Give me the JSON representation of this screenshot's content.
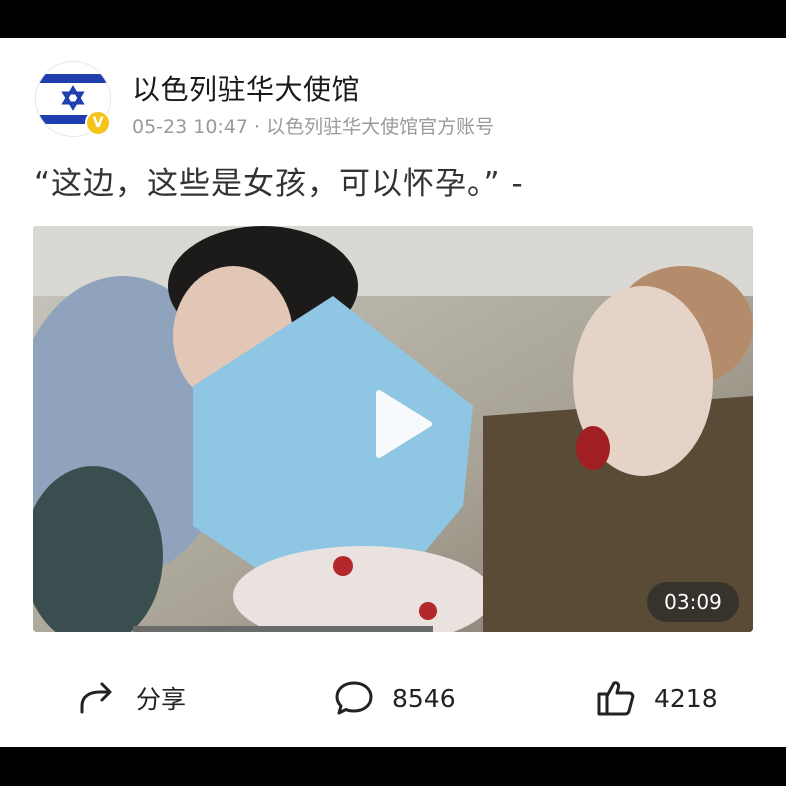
{
  "post": {
    "account_name": "以色列驻华大使馆",
    "meta": "05-23 10:47 · 以色列驻华大使馆官方账号",
    "verified_badge": "V",
    "text": "“这边，这些是女孩，可以怀孕。” -"
  },
  "video": {
    "duration": "03:09"
  },
  "actions": {
    "share_label": "分享",
    "comment_count": "8546",
    "like_count": "4218"
  },
  "icons": {
    "avatar": "israel-flag-icon",
    "share": "share-arrow-icon",
    "comment": "comment-bubble-icon",
    "like": "thumbs-up-icon",
    "play": "play-icon"
  },
  "colors": {
    "flag_blue": "#1f3fae",
    "verified": "#f7c21a",
    "text_primary": "#1a1a1a",
    "text_meta": "#9a9a9a"
  }
}
